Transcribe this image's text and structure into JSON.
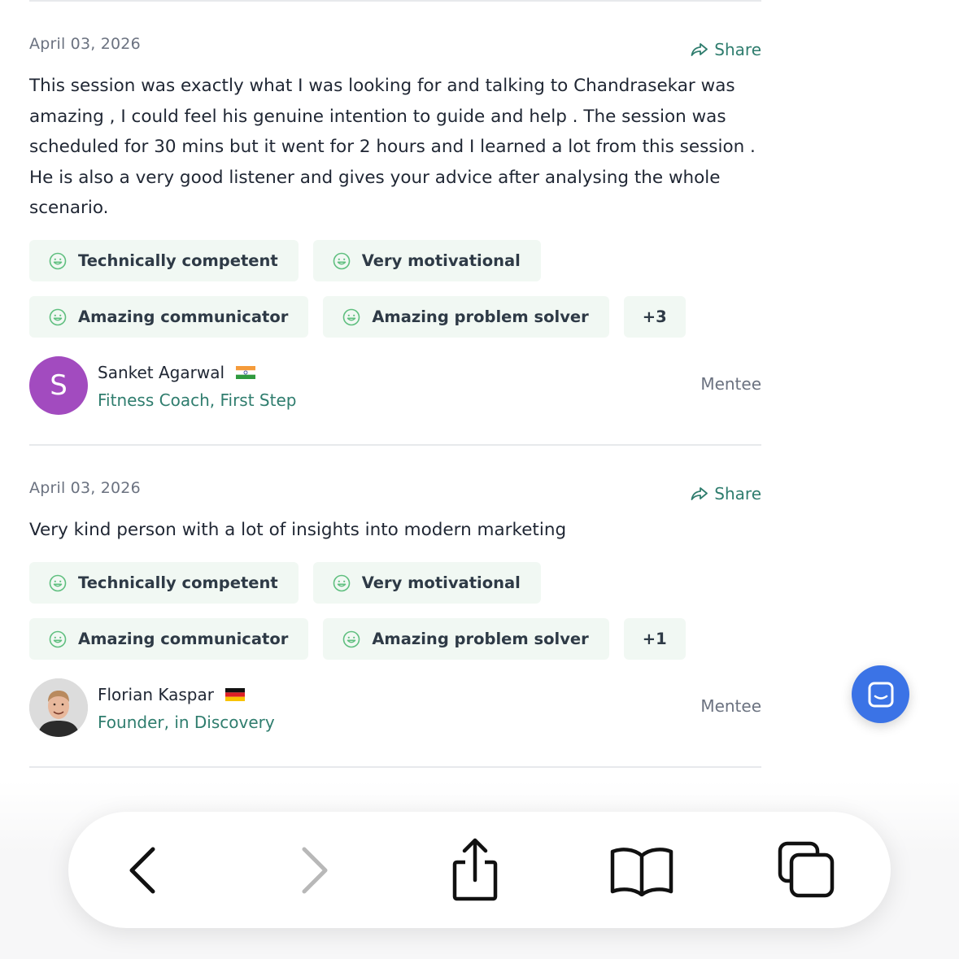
{
  "reviews": [
    {
      "date": "April 03, 2026",
      "share_label": "Share",
      "text": "This session was exactly what I was looking for and talking to Chandrasekar was amazing , I could feel his genuine intention to guide and help . The session was scheduled for 30 mins but it went for 2 hours and I learned a lot from this session . He is also a very good listener and gives your advice after analysing the whole scenario.",
      "tags": [
        "Technically competent",
        "Very motivational",
        "Amazing communicator",
        "Amazing problem solver"
      ],
      "more_tags": "+3",
      "reviewer": {
        "avatar_letter": "S",
        "avatar_color": "#a24bbf",
        "name": "Sanket Agarwal",
        "flag": "india-flag",
        "role": "Fitness Coach, First Step",
        "type": "Mentee"
      }
    },
    {
      "date": "April 03, 2026",
      "share_label": "Share",
      "text": "Very kind person with a lot of insights into modern marketing",
      "tags": [
        "Technically competent",
        "Very motivational",
        "Amazing communicator",
        "Amazing problem solver"
      ],
      "more_tags": "+1",
      "reviewer": {
        "avatar_letter": "",
        "name": "Florian Kaspar",
        "flag": "germany-flag",
        "role": "Founder, in Discovery",
        "type": "Mentee"
      }
    }
  ],
  "colors": {
    "accent_green": "#2f7d6e",
    "tag_background": "#f1f8f3",
    "chat_button": "#3b73e6"
  },
  "toolbar": {
    "buttons": [
      "back-icon",
      "forward-icon",
      "share-icon",
      "bookmarks-icon",
      "tabs-icon"
    ]
  }
}
